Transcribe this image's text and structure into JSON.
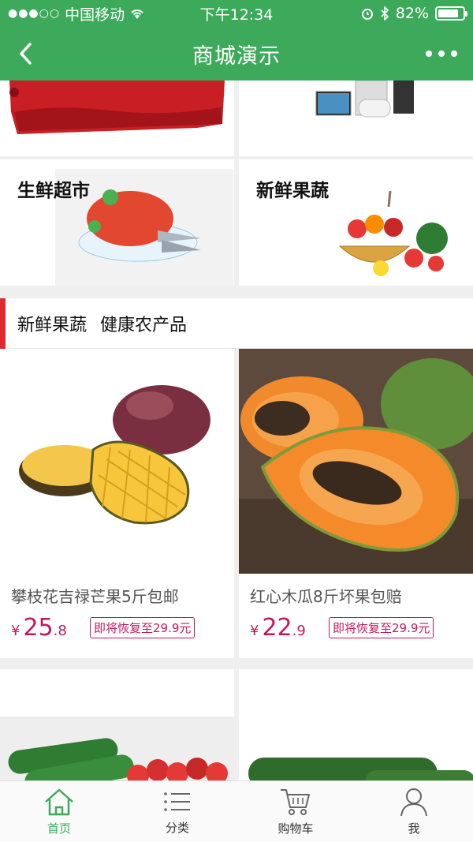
{
  "status": {
    "carrier": "中国移动",
    "time": "下午12:34",
    "battery": "82%",
    "battery_level": 0.82
  },
  "nav": {
    "title": "商城演示"
  },
  "tiles": [
    {
      "label": "生鲜超市"
    },
    {
      "label": "新鲜果蔬"
    }
  ],
  "section": {
    "title": "新鲜果蔬   健康农产品"
  },
  "products": [
    {
      "name": "攀枝花吉禄芒果5斤包邮",
      "yen": "¥",
      "price_int": "25",
      "price_dec": ".8",
      "badge": "即将恢复至29.9元"
    },
    {
      "name": "红心木瓜8斤坏果包赔",
      "yen": "¥",
      "price_int": "22",
      "price_dec": ".9",
      "badge": "即将恢复至29.9元"
    }
  ],
  "tabs": [
    {
      "label": "首页",
      "icon": "home-icon"
    },
    {
      "label": "分类",
      "icon": "list-icon"
    },
    {
      "label": "购物车",
      "icon": "cart-icon"
    },
    {
      "label": "我",
      "icon": "person-icon"
    }
  ],
  "colors": {
    "brand": "#3daa5b",
    "price": "#c2185b",
    "section_bar": "#e0292e"
  }
}
